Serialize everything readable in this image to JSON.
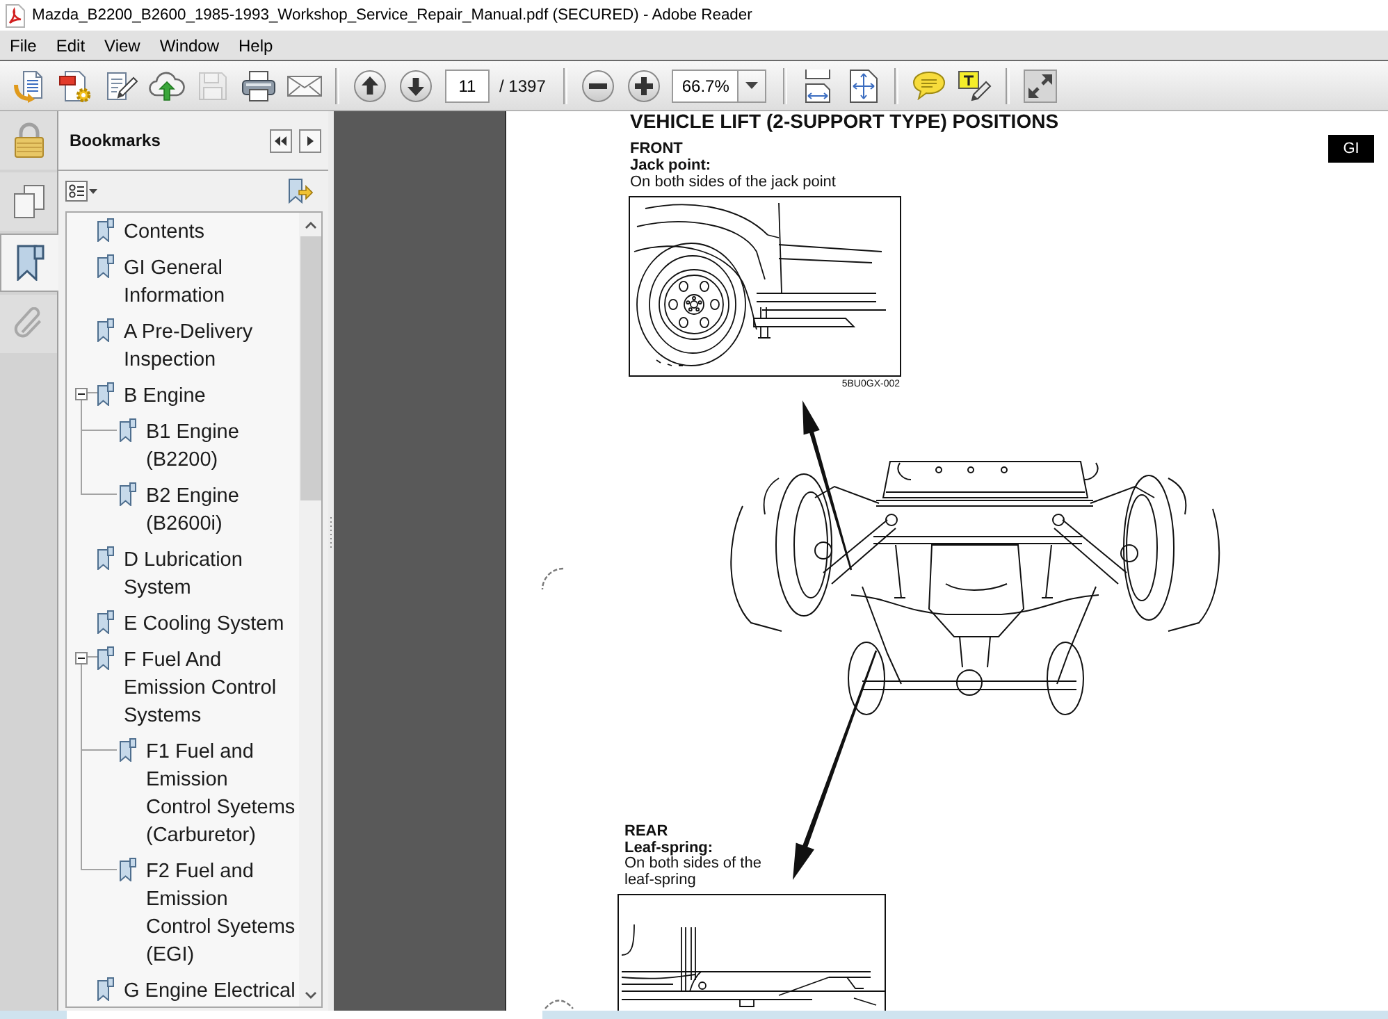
{
  "window": {
    "title": "Mazda_B2200_B2600_1985-1993_Workshop_Service_Repair_Manual.pdf (SECURED) - Adobe Reader"
  },
  "menu": [
    "File",
    "Edit",
    "View",
    "Window",
    "Help"
  ],
  "toolbar": {
    "groups": [
      [
        {
          "kind": "open",
          "disabled": false
        },
        {
          "kind": "create",
          "disabled": false
        },
        {
          "kind": "sign",
          "disabled": false
        },
        {
          "kind": "upload",
          "disabled": false
        },
        {
          "kind": "save",
          "disabled": true
        },
        {
          "kind": "print",
          "disabled": false
        },
        {
          "kind": "email",
          "disabled": false
        }
      ],
      [
        {
          "kind": "previous-page",
          "disabled": false
        },
        {
          "kind": "next-page",
          "disabled": false
        },
        {
          "kind": "page-field",
          "value": "11",
          "total": "/ 1397"
        }
      ],
      [
        {
          "kind": "zoom-out",
          "disabled": false
        },
        {
          "kind": "zoom-in",
          "disabled": false
        },
        {
          "kind": "zoom-field",
          "value": "66.7%"
        }
      ],
      [
        {
          "kind": "scroll-mode",
          "disabled": false
        },
        {
          "kind": "fit-page",
          "disabled": false
        }
      ],
      [
        {
          "kind": "comment",
          "disabled": false
        },
        {
          "kind": "highlight",
          "disabled": false
        }
      ],
      [
        {
          "kind": "full-screen",
          "disabled": false
        }
      ]
    ]
  },
  "navigation_pane": [
    {
      "kind": "security",
      "selected": false
    },
    {
      "kind": "pages",
      "selected": false
    },
    {
      "kind": "bookmarks",
      "selected": true
    },
    {
      "kind": "attachments",
      "selected": false
    }
  ],
  "bookmarks": {
    "title": "Bookmarks",
    "items": [
      {
        "label": "Contents"
      },
      {
        "label": "GI General Information"
      },
      {
        "label": "A Pre-Delivery Inspection"
      },
      {
        "label": "B Engine",
        "expanded": true,
        "children": [
          {
            "label": "B1 Engine (B2200)"
          },
          {
            "label": "B2 Engine (B2600i)"
          }
        ]
      },
      {
        "label": "D Lubrication System"
      },
      {
        "label": "E Cooling System"
      },
      {
        "label": "F Fuel And Emission Control Systems",
        "expanded": true,
        "children": [
          {
            "label": "F1 Fuel and Emission Control Syetems (Carburetor)"
          },
          {
            "label": "F2 Fuel and Emission Control Syetems (EGI)"
          }
        ]
      },
      {
        "label": "G Engine Electrical"
      }
    ]
  },
  "page": {
    "section_tab": "GI",
    "heading": "VEHICLE LIFT (2-SUPPORT TYPE) POSITIONS",
    "front": {
      "title": "FRONT",
      "label": "Jack point:",
      "note": "On both sides of the jack point",
      "figure_code": "5BU0GX-002"
    },
    "rear": {
      "title": "REAR",
      "label": "Leaf-spring:",
      "note": "On both sides of the leaf-spring"
    }
  }
}
